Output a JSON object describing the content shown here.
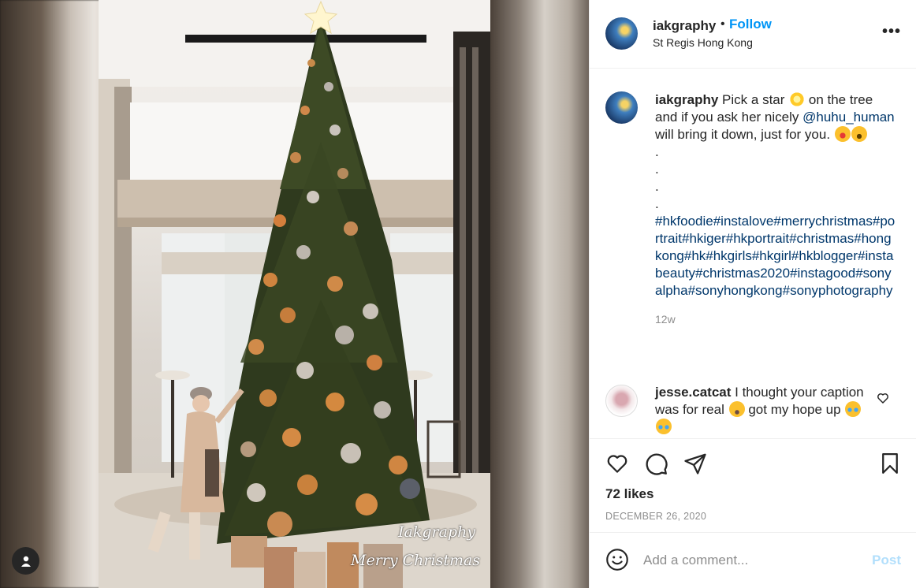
{
  "post": {
    "username": "iakgraphy",
    "separator": "•",
    "follow_label": "Follow",
    "location": "St Regis Hong Kong",
    "more_label": "•••"
  },
  "photo": {
    "watermark_line1": "Iakgraphy",
    "watermark_line2": "Merry Christmas"
  },
  "caption": {
    "username": "iakgraphy",
    "text_part1": "Pick a star",
    "text_part2": "on the tree and if you ask her nicely",
    "mention": "@huhu_human",
    "text_part3": "will bring it down, just for you.",
    "dots": [
      ".",
      ".",
      ".",
      "."
    ],
    "hashtags": "#hkfoodie#instalove#merrychristmas#portrait#hkiger#hkportrait#christmas#hongkong#hk#hkgirls#hkgirl#hkblogger#instabeauty#christmas2020#instagood#sonyalpha#sonyhongkong#sonyphotography",
    "time": "12w"
  },
  "comment": {
    "username": "jesse.catcat",
    "text_part1": "I thought your caption was for real",
    "text_part2": "got my hope up"
  },
  "stats": {
    "likes": "72 likes",
    "date": "DECEMBER 26, 2020"
  },
  "add_comment": {
    "placeholder": "Add a comment...",
    "post_label": "Post"
  },
  "icons": {
    "like": "heart-icon",
    "comment": "speech-bubble-icon",
    "share": "paper-plane-icon",
    "save": "bookmark-icon",
    "emoji": "smiley-icon",
    "profile": "person-icon"
  },
  "colors": {
    "link_blue": "#0095f6",
    "hashtag": "#00376b",
    "muted": "#8e8e8e",
    "post_disabled": "#b2dffc"
  }
}
